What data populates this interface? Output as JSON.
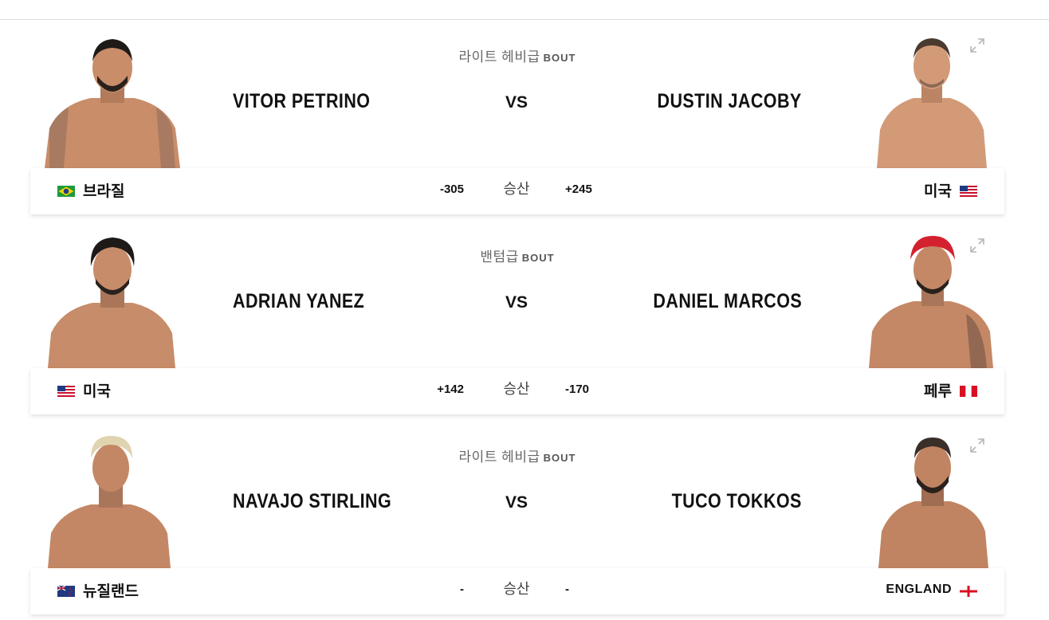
{
  "bouts": [
    {
      "weight_class": "라이트 헤비급",
      "bout_word": "BOUT",
      "vs_label": "VS",
      "odds_label": "승산",
      "red": {
        "name": "VITOR PETRINO",
        "country": "브라질",
        "odds": "-305",
        "flag": "brazil-flag-icon"
      },
      "blue": {
        "name": "DUSTIN JACOBY",
        "country": "미국",
        "odds": "+245",
        "flag": "usa-flag-icon"
      }
    },
    {
      "weight_class": "밴텀급",
      "bout_word": "BOUT",
      "vs_label": "VS",
      "odds_label": "승산",
      "red": {
        "name": "ADRIAN YANEZ",
        "country": "미국",
        "odds": "+142",
        "flag": "usa-flag-icon"
      },
      "blue": {
        "name": "DANIEL MARCOS",
        "country": "페루",
        "odds": "-170",
        "flag": "peru-flag-icon"
      }
    },
    {
      "weight_class": "라이트 헤비급",
      "bout_word": "BOUT",
      "vs_label": "VS",
      "odds_label": "승산",
      "red": {
        "name": "NAVAJO STIRLING",
        "country": "뉴질랜드",
        "odds": "-",
        "flag": "new-zealand-flag-icon"
      },
      "blue": {
        "name": "TUCO TOKKOS",
        "country": "ENGLAND",
        "odds": "-",
        "flag": "england-flag-icon"
      }
    }
  ],
  "colors": {
    "skin": "#c98d6a",
    "skin_shadow": "#a86f50",
    "hair_dark": "#1e1a18",
    "hair_red": "#d3212f",
    "hair_blond": "#e0d3b0",
    "bar_shadow": "#e2e2e2"
  }
}
